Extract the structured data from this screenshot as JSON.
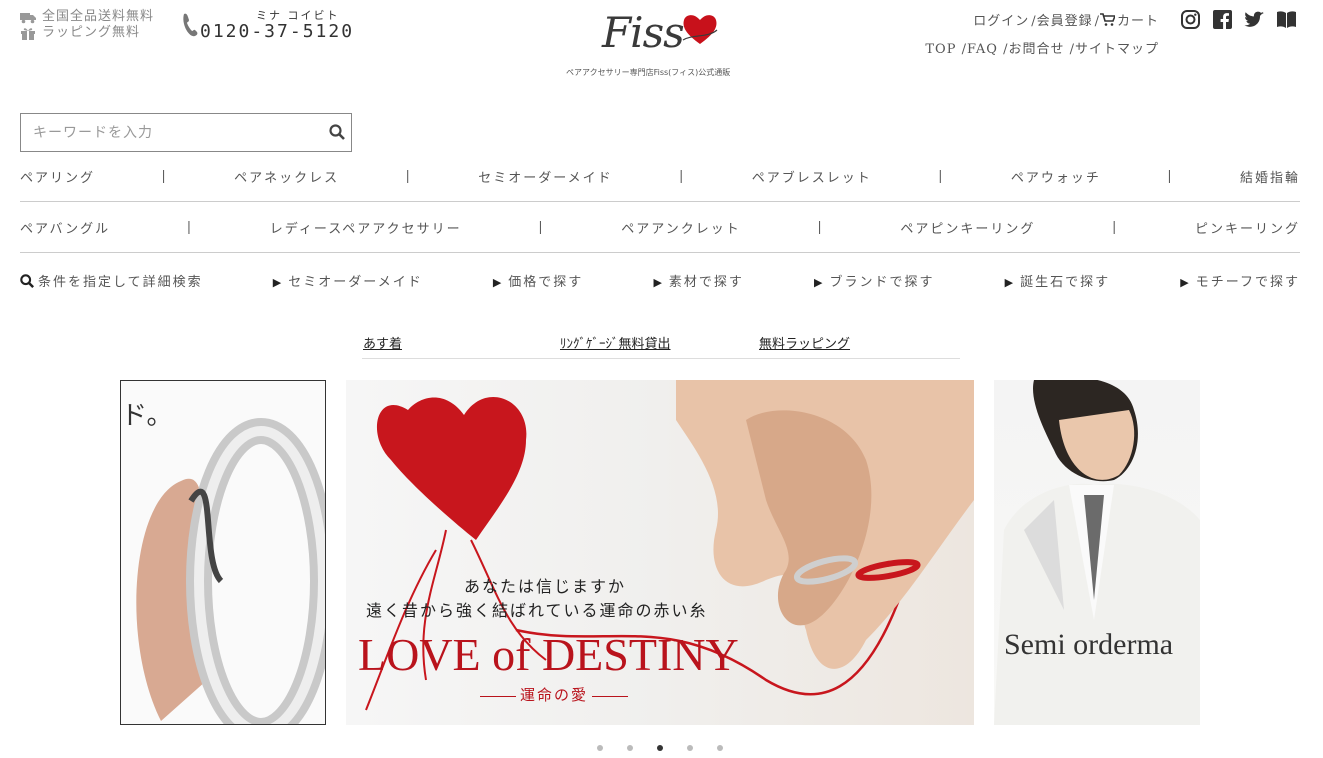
{
  "header": {
    "free_shipping": "全国全品送料無料",
    "free_wrapping": "ラッピング無料",
    "phone_kana": "ミナ コイビト",
    "phone_number": "0120-37-5120",
    "logo_text": "Fiss",
    "logo_sub": "ペアアクセサリー専門店Fiss(フィス)公式通販",
    "account_links": [
      "ログイン",
      "/会員登録",
      "/",
      "カート"
    ],
    "nav_links": [
      "TOP",
      "/FAQ",
      "/お問合せ",
      "/サイトマップ"
    ],
    "social": [
      "instagram-icon",
      "facebook-icon",
      "twitter-icon",
      "book-icon"
    ]
  },
  "search": {
    "placeholder": "キーワードを入力"
  },
  "categories_row1": [
    "ペアリング",
    "ペアネックレス",
    "セミオーダーメイド",
    "ペアブレスレット",
    "ペアウォッチ",
    "結婚指輪"
  ],
  "categories_row2": [
    "ペアバングル",
    "レディースペアアクセサリー",
    "ペアアンクレット",
    "ペアピンキーリング",
    "ピンキーリング"
  ],
  "categories_row3": [
    "条件を指定して詳細検索",
    "セミオーダーメイド",
    "価格で探す",
    "素材で探す",
    "ブランドで探す",
    "誕生石で探す",
    "モチーフで探す"
  ],
  "promo_links": [
    "あす着",
    "ﾘﾝｸﾞｹﾞｰｼﾞ無料貸出",
    "無料ラッピング"
  ],
  "slider": {
    "left_text": "ド。",
    "center_caption1": "あなたは信じますか",
    "center_caption2": "遠く昔から強く結ばれている運命の赤い糸",
    "center_title": "LOVE of DESTINY",
    "center_subtitle": "運命の愛",
    "right_text": "Semi orderma",
    "dots_count": 5,
    "active_dot": 3
  },
  "colors": {
    "accent_red": "#b9131c",
    "text": "#555555"
  }
}
